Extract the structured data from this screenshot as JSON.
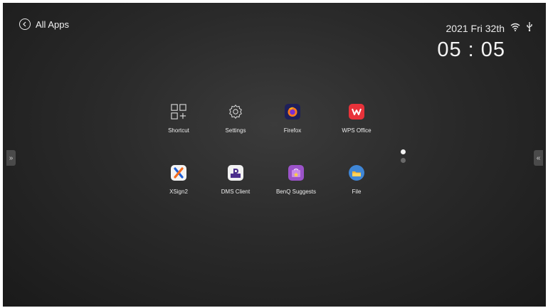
{
  "header": {
    "back_label": "All Apps",
    "date": "2021 Fri 32th",
    "time": "05 : 05"
  },
  "status_icons": [
    "wifi-icon",
    "usb-icon"
  ],
  "edge_controls": {
    "left_glyph": "»",
    "right_glyph": "«"
  },
  "apps": [
    {
      "label": "Shortcut",
      "icon": "shortcut-icon"
    },
    {
      "label": "Settings",
      "icon": "gear-icon"
    },
    {
      "label": "Firefox",
      "icon": "firefox-icon",
      "color": "#1e1f5b"
    },
    {
      "label": "WPS Office",
      "icon": "wps-icon",
      "color": "#e8323a"
    },
    {
      "label": "XSign2",
      "icon": "xsign-icon",
      "color": "#f3f3f3"
    },
    {
      "label": "DMS Client",
      "icon": "dms-icon",
      "color": "#f1f1f1"
    },
    {
      "label": "BenQ Suggests",
      "icon": "benq-suggests-icon",
      "color": "#9b53c9"
    },
    {
      "label": "File",
      "icon": "file-icon",
      "color": "#3f86d6"
    }
  ],
  "pagination": {
    "total": 2,
    "current": 1
  }
}
